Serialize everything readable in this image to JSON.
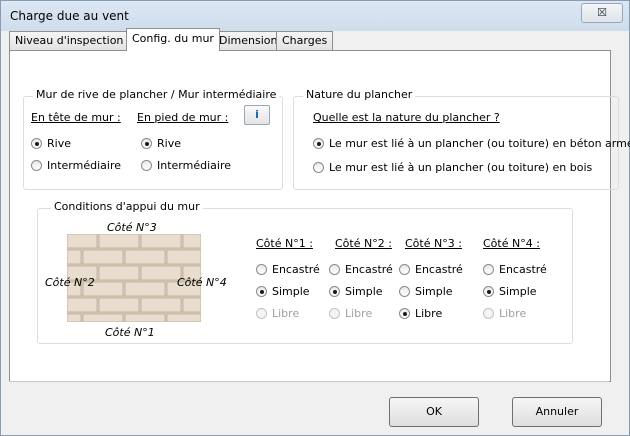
{
  "window": {
    "title": "Charge due au vent",
    "close_glyph": "☒"
  },
  "tabs": [
    {
      "label": "Niveau d'inspection",
      "active": false
    },
    {
      "label": "Config. du mur",
      "active": true
    },
    {
      "label": "Dimensions",
      "active": false
    },
    {
      "label": "Charges",
      "active": false
    }
  ],
  "mur_group": {
    "legend": "Mur de rive de plancher / Mur intermédiaire",
    "en_tete_label": "En tête de mur :",
    "en_pied_label": "En pied de mur :",
    "info_label": "i",
    "en_tete": [
      {
        "label": "Rive",
        "checked": true
      },
      {
        "label": "Intermédiaire",
        "checked": false
      }
    ],
    "en_pied": [
      {
        "label": "Rive",
        "checked": true
      },
      {
        "label": "Intermédiaire",
        "checked": false
      }
    ]
  },
  "plancher_group": {
    "legend": "Nature du plancher",
    "question": "Quelle est la nature du plancher ?",
    "options": [
      {
        "label": "Le mur est lié à un plancher (ou toiture) en béton armé",
        "checked": true
      },
      {
        "label": "Le mur est lié à un plancher (ou toiture) en bois",
        "checked": false
      }
    ]
  },
  "appui_group": {
    "legend": "Conditions d'appui du mur",
    "wall_labels": {
      "cote3": "Côté N°3",
      "cote2": "Côté N°2",
      "cote4": "Côté N°4",
      "cote1": "Côté N°1"
    },
    "columns": [
      {
        "header": "Côté N°1 :",
        "options": [
          {
            "label": "Encastré",
            "checked": false,
            "disabled": false
          },
          {
            "label": "Simple",
            "checked": true,
            "disabled": false
          },
          {
            "label": "Libre",
            "checked": false,
            "disabled": true
          }
        ]
      },
      {
        "header": "Côté N°2 :",
        "options": [
          {
            "label": "Encastré",
            "checked": false,
            "disabled": false
          },
          {
            "label": "Simple",
            "checked": true,
            "disabled": false
          },
          {
            "label": "Libre",
            "checked": false,
            "disabled": true
          }
        ]
      },
      {
        "header": "Côté N°3 :",
        "options": [
          {
            "label": "Encastré",
            "checked": false,
            "disabled": false
          },
          {
            "label": "Simple",
            "checked": false,
            "disabled": false
          },
          {
            "label": "Libre",
            "checked": true,
            "disabled": false
          }
        ]
      },
      {
        "header": "Côté N°4 :",
        "options": [
          {
            "label": "Encastré",
            "checked": false,
            "disabled": false
          },
          {
            "label": "Simple",
            "checked": true,
            "disabled": false
          },
          {
            "label": "Libre",
            "checked": false,
            "disabled": true
          }
        ]
      }
    ]
  },
  "buttons": {
    "ok": "OK",
    "cancel": "Annuler"
  }
}
